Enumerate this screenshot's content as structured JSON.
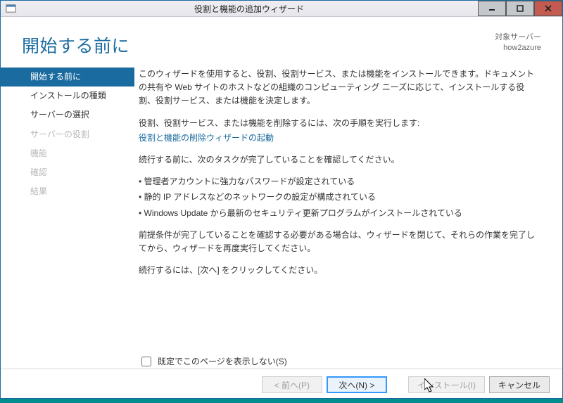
{
  "window": {
    "title": "役割と機能の追加ウィザード"
  },
  "header": {
    "page_title": "開始する前に",
    "target_label": "対象サーバー",
    "target_server": "how2azure"
  },
  "sidebar": {
    "items": [
      {
        "label": "開始する前に",
        "state": "selected"
      },
      {
        "label": "インストールの種類",
        "state": "enabled"
      },
      {
        "label": "サーバーの選択",
        "state": "enabled"
      },
      {
        "label": "サーバーの役割",
        "state": "disabled"
      },
      {
        "label": "機能",
        "state": "disabled"
      },
      {
        "label": "確認",
        "state": "disabled"
      },
      {
        "label": "結果",
        "state": "disabled"
      }
    ]
  },
  "body": {
    "intro": "このウィザードを使用すると、役割、役割サービス、または機能をインストールできます。ドキュメントの共有や Web サイトのホストなどの組織のコンピューティング ニーズに応じて、インストールする役割、役割サービス、または機能を決定します。",
    "remove_lead": "役割、役割サービス、または機能を削除するには、次の手順を実行します:",
    "remove_link": "役割と機能の削除ウィザードの起動",
    "prereq_lead": "続行する前に、次のタスクが完了していることを確認してください。",
    "bullets": [
      "管理者アカウントに強力なパスワードが設定されている",
      "静的 IP アドレスなどのネットワークの設定が構成されている",
      "Windows Update から最新のセキュリティ更新プログラムがインストールされている"
    ],
    "prereq_note": "前提条件が完了していることを確認する必要がある場合は、ウィザードを閉じて、それらの作業を完了してから、ウィザードを再度実行してください。",
    "continue_note": "続行するには、[次へ] をクリックしてください。",
    "skip_checkbox": "既定でこのページを表示しない(S)"
  },
  "footer": {
    "prev": "< 前へ(P)",
    "next": "次へ(N) >",
    "install": "インストール(I)",
    "cancel": "キャンセル"
  }
}
